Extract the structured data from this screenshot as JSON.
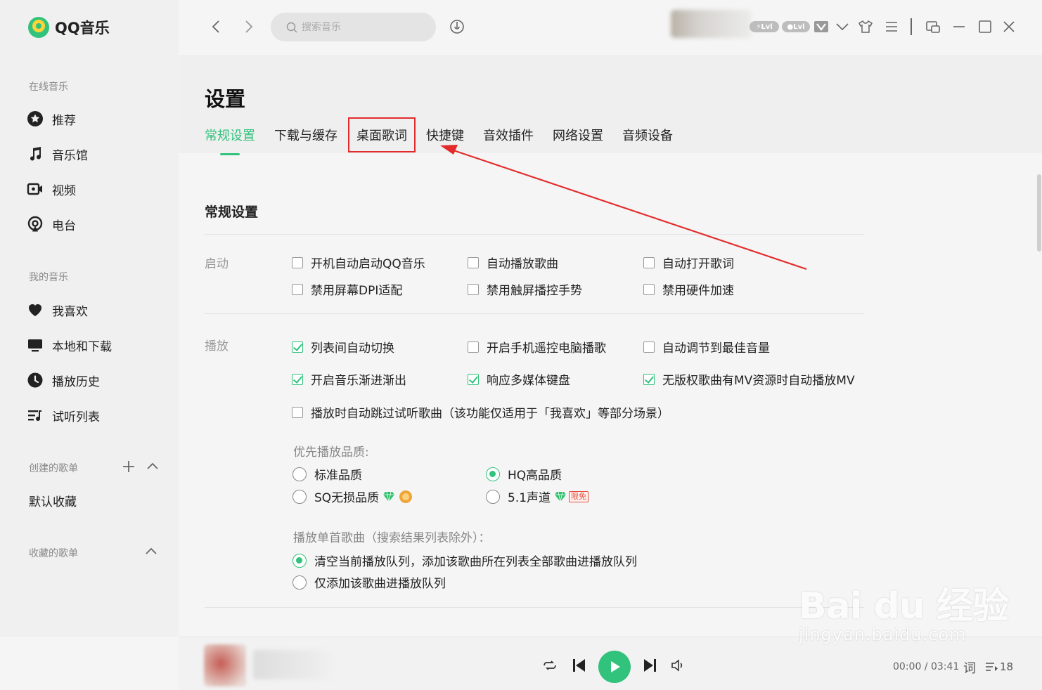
{
  "app": {
    "name": "QQ音乐"
  },
  "sidebar": {
    "online_title": "在线音乐",
    "online_items": [
      {
        "label": "推荐",
        "icon": "star-circle-icon"
      },
      {
        "label": "音乐馆",
        "icon": "music-note-icon"
      },
      {
        "label": "视频",
        "icon": "video-icon"
      },
      {
        "label": "电台",
        "icon": "radio-icon"
      }
    ],
    "my_title": "我的音乐",
    "my_items": [
      {
        "label": "我喜欢",
        "icon": "heart-icon"
      },
      {
        "label": "本地和下载",
        "icon": "monitor-icon"
      },
      {
        "label": "播放历史",
        "icon": "clock-icon"
      },
      {
        "label": "试听列表",
        "icon": "playlist-icon"
      }
    ],
    "created_title": "创建的歌单",
    "created_items": [
      "默认收藏"
    ],
    "collected_title": "收藏的歌单"
  },
  "topbar": {
    "search_placeholder": "搜索音乐",
    "level_badge": "Lvl"
  },
  "page": {
    "title": "设置",
    "tabs": [
      {
        "label": "常规设置",
        "active": true
      },
      {
        "label": "下载与缓存",
        "active": false
      },
      {
        "label": "桌面歌词",
        "active": false,
        "highlighted": true
      },
      {
        "label": "快捷键",
        "active": false
      },
      {
        "label": "音效插件",
        "active": false
      },
      {
        "label": "网络设置",
        "active": false
      },
      {
        "label": "音频设备",
        "active": false
      }
    ],
    "section_title": "常规设置",
    "startup": {
      "label": "启动",
      "options": [
        {
          "label": "开机自动启动QQ音乐",
          "checked": false
        },
        {
          "label": "自动播放歌曲",
          "checked": false
        },
        {
          "label": "自动打开歌词",
          "checked": false
        },
        {
          "label": "禁用屏幕DPI适配",
          "checked": false
        },
        {
          "label": "禁用触屏播控手势",
          "checked": false
        },
        {
          "label": "禁用硬件加速",
          "checked": false
        }
      ]
    },
    "playback": {
      "label": "播放",
      "options": [
        {
          "label": "列表间自动切换",
          "checked": true
        },
        {
          "label": "开启手机遥控电脑播歌",
          "checked": false
        },
        {
          "label": "自动调节到最佳音量",
          "checked": false
        },
        {
          "label": "开启音乐渐进渐出",
          "checked": true
        },
        {
          "label": "响应多媒体键盘",
          "checked": true
        },
        {
          "label": "无版权歌曲有MV资源时自动播放MV",
          "checked": true
        },
        {
          "label": "播放时自动跳过试听歌曲（该功能仅适用于「我喜欢」等部分场景）",
          "checked": false
        }
      ],
      "quality_label": "优先播放品质:",
      "quality_options": [
        {
          "label": "标准品质",
          "selected": false
        },
        {
          "label": "HQ高品质",
          "selected": true
        },
        {
          "label": "SQ无损品质",
          "selected": false
        },
        {
          "label": "5.1声道",
          "selected": false,
          "badge": "限免"
        }
      ],
      "single_label": "播放单首歌曲（搜索结果列表除外）：",
      "single_options": [
        {
          "label": "清空当前播放队列，添加该歌曲所在列表全部歌曲进播放队列",
          "selected": true
        },
        {
          "label": "仅添加该歌曲进播放队列",
          "selected": false
        }
      ]
    }
  },
  "player": {
    "current_time": "00:00",
    "total_time": "03:41",
    "lyric_label": "词",
    "queue_count": "18"
  },
  "watermark": {
    "main": "Bai du 经验",
    "sub": "jingyan.baidu.com"
  },
  "colors": {
    "accent": "#31c27c",
    "annotation": "#e32b2b"
  }
}
